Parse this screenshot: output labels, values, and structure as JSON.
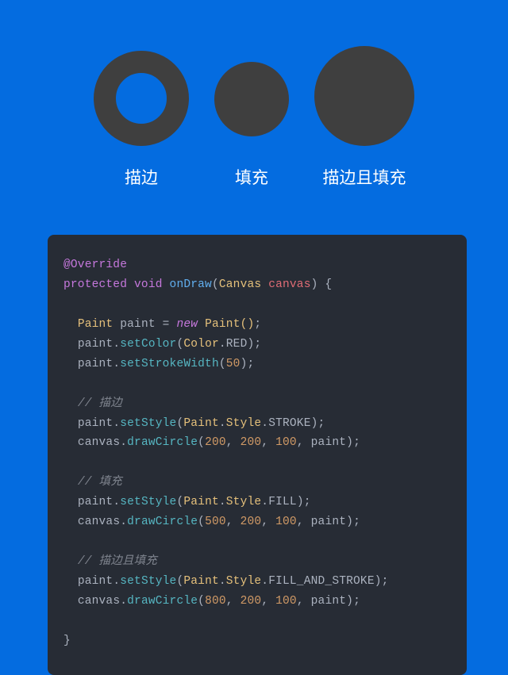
{
  "shapes": {
    "stroke_label": "描边",
    "fill_label": "填充",
    "stroke_and_fill_label": "描边且填充"
  },
  "code": {
    "annotation": "@Override",
    "protected": "protected",
    "void": "void",
    "onDraw": "onDraw",
    "Canvas": "Canvas",
    "canvas_param": "canvas",
    "open_brace": " {",
    "Paint": "Paint",
    "paint_var": "paint",
    "equals": " = ",
    "new_kw": "new",
    "Paint_ctor": "Paint()",
    "semi": ";",
    "setColor": "setColor",
    "Color": "Color",
    "dot": ".",
    "RED": "RED",
    "setStrokeWidth": "setStrokeWidth",
    "fifty": "50",
    "comment_stroke": "// 描边",
    "setStyle": "setStyle",
    "Style": "Style",
    "STROKE": "STROKE",
    "drawCircle": "drawCircle",
    "n200": "200",
    "n100": "100",
    "n500": "500",
    "n800": "800",
    "paint_arg": "paint",
    "comment_fill": "// 填充",
    "FILL": "FILL",
    "comment_both": "// 描边且填充",
    "FILL_AND_STROKE": "FILL_AND_STROKE",
    "close_brace": "}",
    "comma_sp": ", ",
    "open_paren": "(",
    "close_paren": ")",
    "space": " "
  }
}
